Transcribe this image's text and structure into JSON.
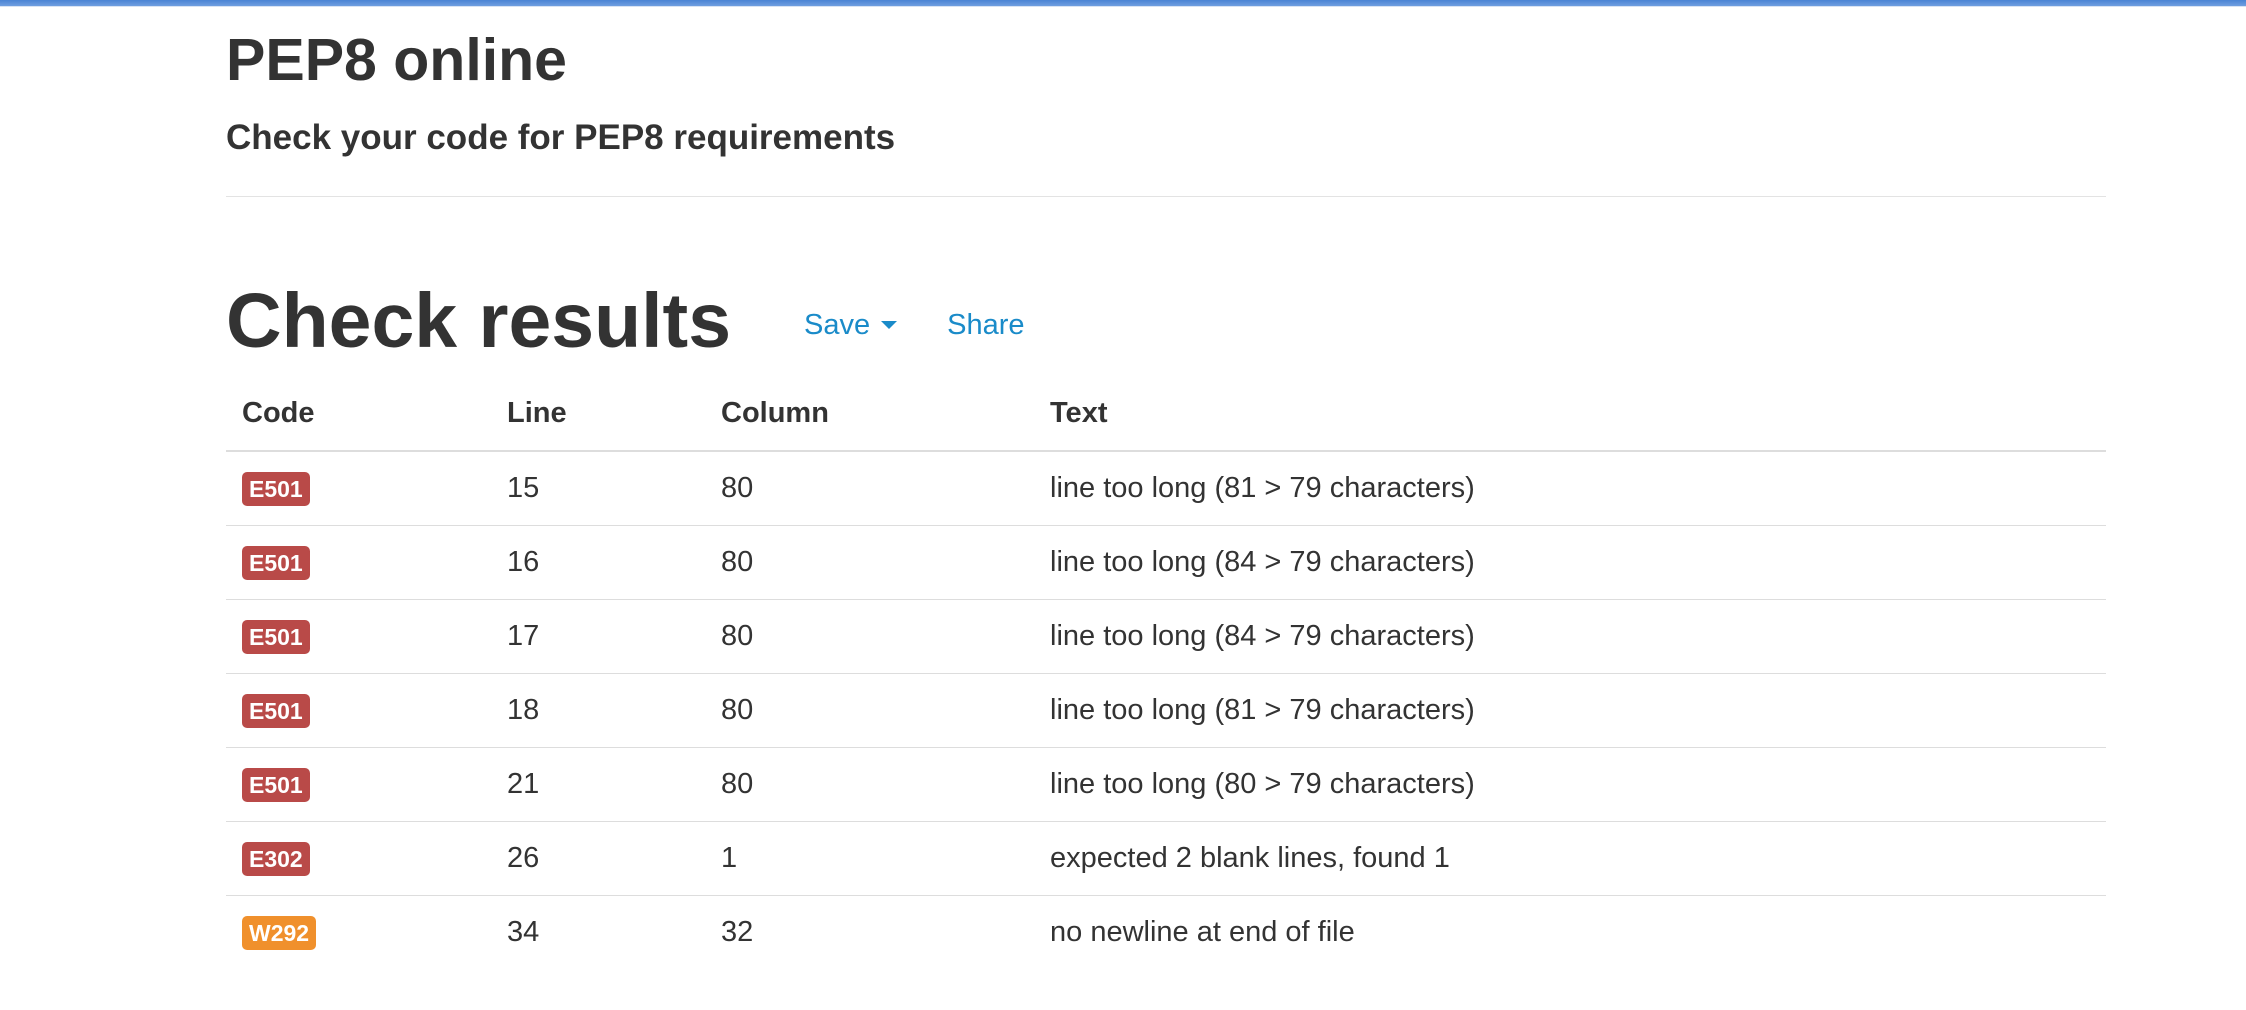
{
  "header": {
    "title": "PEP8 online",
    "subtitle": "Check your code for PEP8 requirements"
  },
  "results": {
    "title": "Check results",
    "save_label": "Save",
    "share_label": "Share",
    "columns": {
      "code": "Code",
      "line": "Line",
      "column": "Column",
      "text": "Text"
    },
    "rows": [
      {
        "code": "E501",
        "severity": "error",
        "line": "15",
        "column": "80",
        "text": "line too long (81 > 79 characters)"
      },
      {
        "code": "E501",
        "severity": "error",
        "line": "16",
        "column": "80",
        "text": "line too long (84 > 79 characters)"
      },
      {
        "code": "E501",
        "severity": "error",
        "line": "17",
        "column": "80",
        "text": "line too long (84 > 79 characters)"
      },
      {
        "code": "E501",
        "severity": "error",
        "line": "18",
        "column": "80",
        "text": "line too long (81 > 79 characters)"
      },
      {
        "code": "E501",
        "severity": "error",
        "line": "21",
        "column": "80",
        "text": "line too long (80 > 79 characters)"
      },
      {
        "code": "E302",
        "severity": "error",
        "line": "26",
        "column": "1",
        "text": "expected 2 blank lines, found 1"
      },
      {
        "code": "W292",
        "severity": "warning",
        "line": "34",
        "column": "32",
        "text": "no newline at end of file"
      }
    ]
  },
  "colors": {
    "error_badge": "#b94a48",
    "warning_badge": "#f0902c",
    "link": "#1a8bc9",
    "text": "#333333"
  },
  "icons": {
    "save_dropdown": "caret-down-icon"
  }
}
